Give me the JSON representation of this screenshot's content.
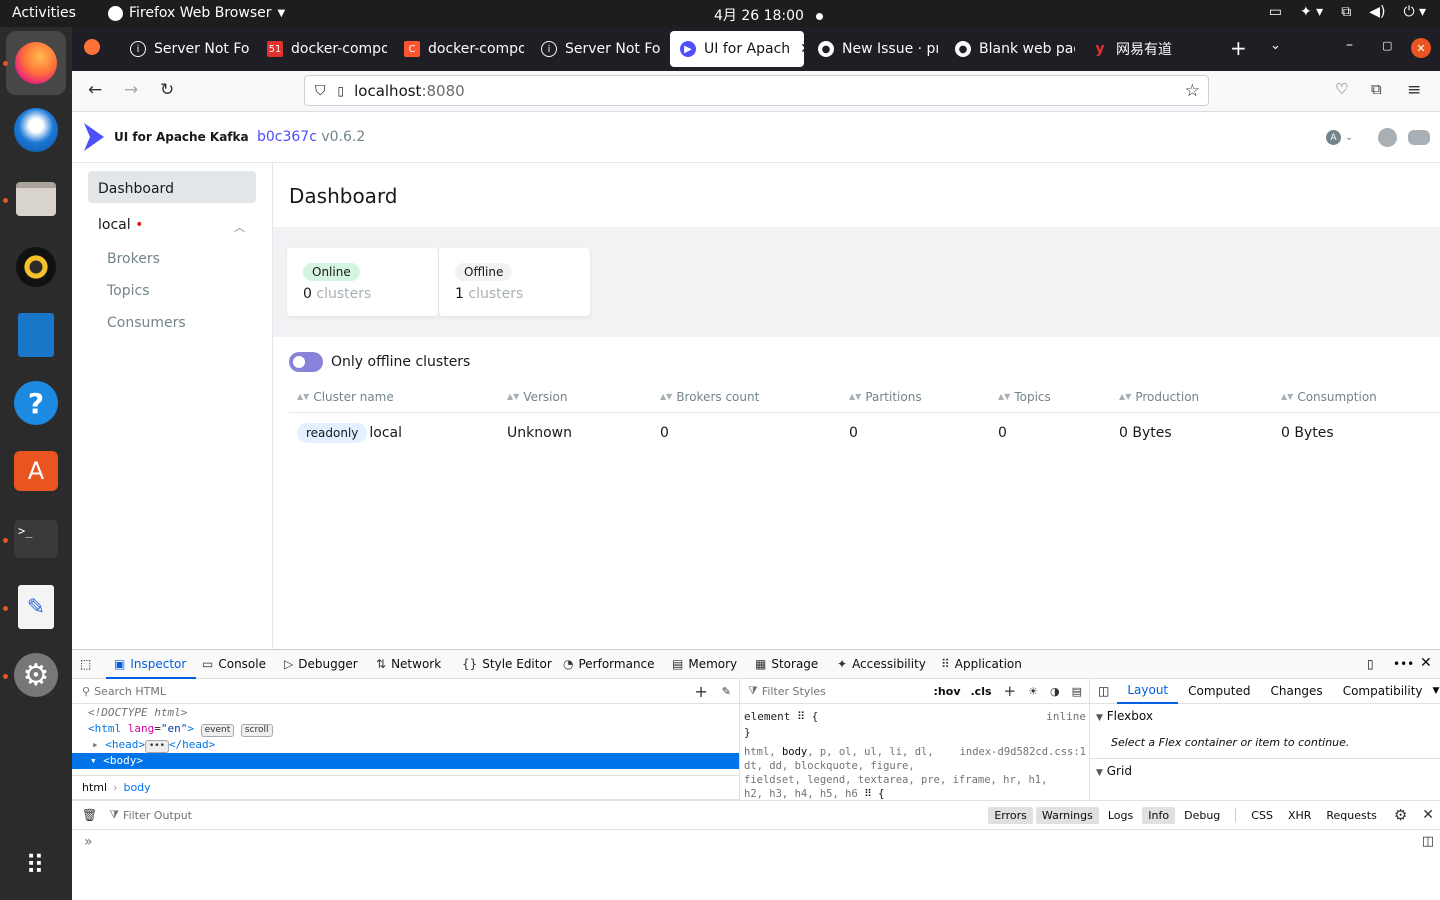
{
  "system": {
    "activities": "Activities",
    "app_name": "Firefox Web Browser",
    "clock": "4月 26  18:00"
  },
  "browser": {
    "tabs": [
      {
        "label": "Server Not Fou",
        "icon": "info-icon"
      },
      {
        "label": "docker-compo",
        "icon": "51-icon"
      },
      {
        "label": "docker-compo",
        "icon": "c-icon"
      },
      {
        "label": "Server Not Fou",
        "icon": "info-icon"
      },
      {
        "label": "UI for Apach",
        "icon": "kafka-icon",
        "selected": true
      },
      {
        "label": "New Issue · pr",
        "icon": "github-icon"
      },
      {
        "label": "Blank web pag",
        "icon": "github-icon"
      },
      {
        "label": "网易有道",
        "icon": "youdao-icon"
      }
    ],
    "url_host": "localhost",
    "url_port": ":8080"
  },
  "app": {
    "brand": "UI for Apache Kafka",
    "commit": "b0c367c",
    "version": "v0.6.2",
    "user_initial": "A"
  },
  "sidebar": {
    "dashboard": "Dashboard",
    "cluster": "local",
    "cluster_dot": "•",
    "items": [
      "Brokers",
      "Topics",
      "Consumers"
    ]
  },
  "main": {
    "title": "Dashboard",
    "online": {
      "label": "Online",
      "count": "0",
      "unit": "clusters"
    },
    "offline": {
      "label": "Offline",
      "count": "1",
      "unit": "clusters"
    },
    "toggle_label": "Only offline clusters",
    "columns": [
      "Cluster name",
      "Version",
      "Brokers count",
      "Partitions",
      "Topics",
      "Production",
      "Consumption"
    ],
    "rows": [
      {
        "badge": "readonly",
        "name": "local",
        "version": "Unknown",
        "brokers": "0",
        "partitions": "0",
        "topics": "0",
        "production": "0 Bytes",
        "consumption": "0 Bytes"
      }
    ]
  },
  "devtools": {
    "tabs": [
      "Inspector",
      "Console",
      "Debugger",
      "Network",
      "Style Editor",
      "Performance",
      "Memory",
      "Storage",
      "Accessibility",
      "Application"
    ],
    "search_placeholder": "Search HTML",
    "filter_styles": "Filter Styles",
    "hov": ":hov",
    "cls": ".cls",
    "right_tabs": [
      "Layout",
      "Computed",
      "Changes",
      "Compatibility"
    ],
    "flexbox": "Flexbox",
    "flexbox_msg": "Select a Flex container or item to continue.",
    "grid": "Grid",
    "breadcrumb": [
      "html",
      "body"
    ],
    "filter_output": "Filter Output",
    "console_filters": [
      "Errors",
      "Warnings",
      "Logs",
      "Info",
      "Debug",
      "CSS",
      "XHR",
      "Requests"
    ],
    "rule_element": "element",
    "rule_inline": "inline",
    "rule_file": "index-d9d582cd.css:1"
  }
}
